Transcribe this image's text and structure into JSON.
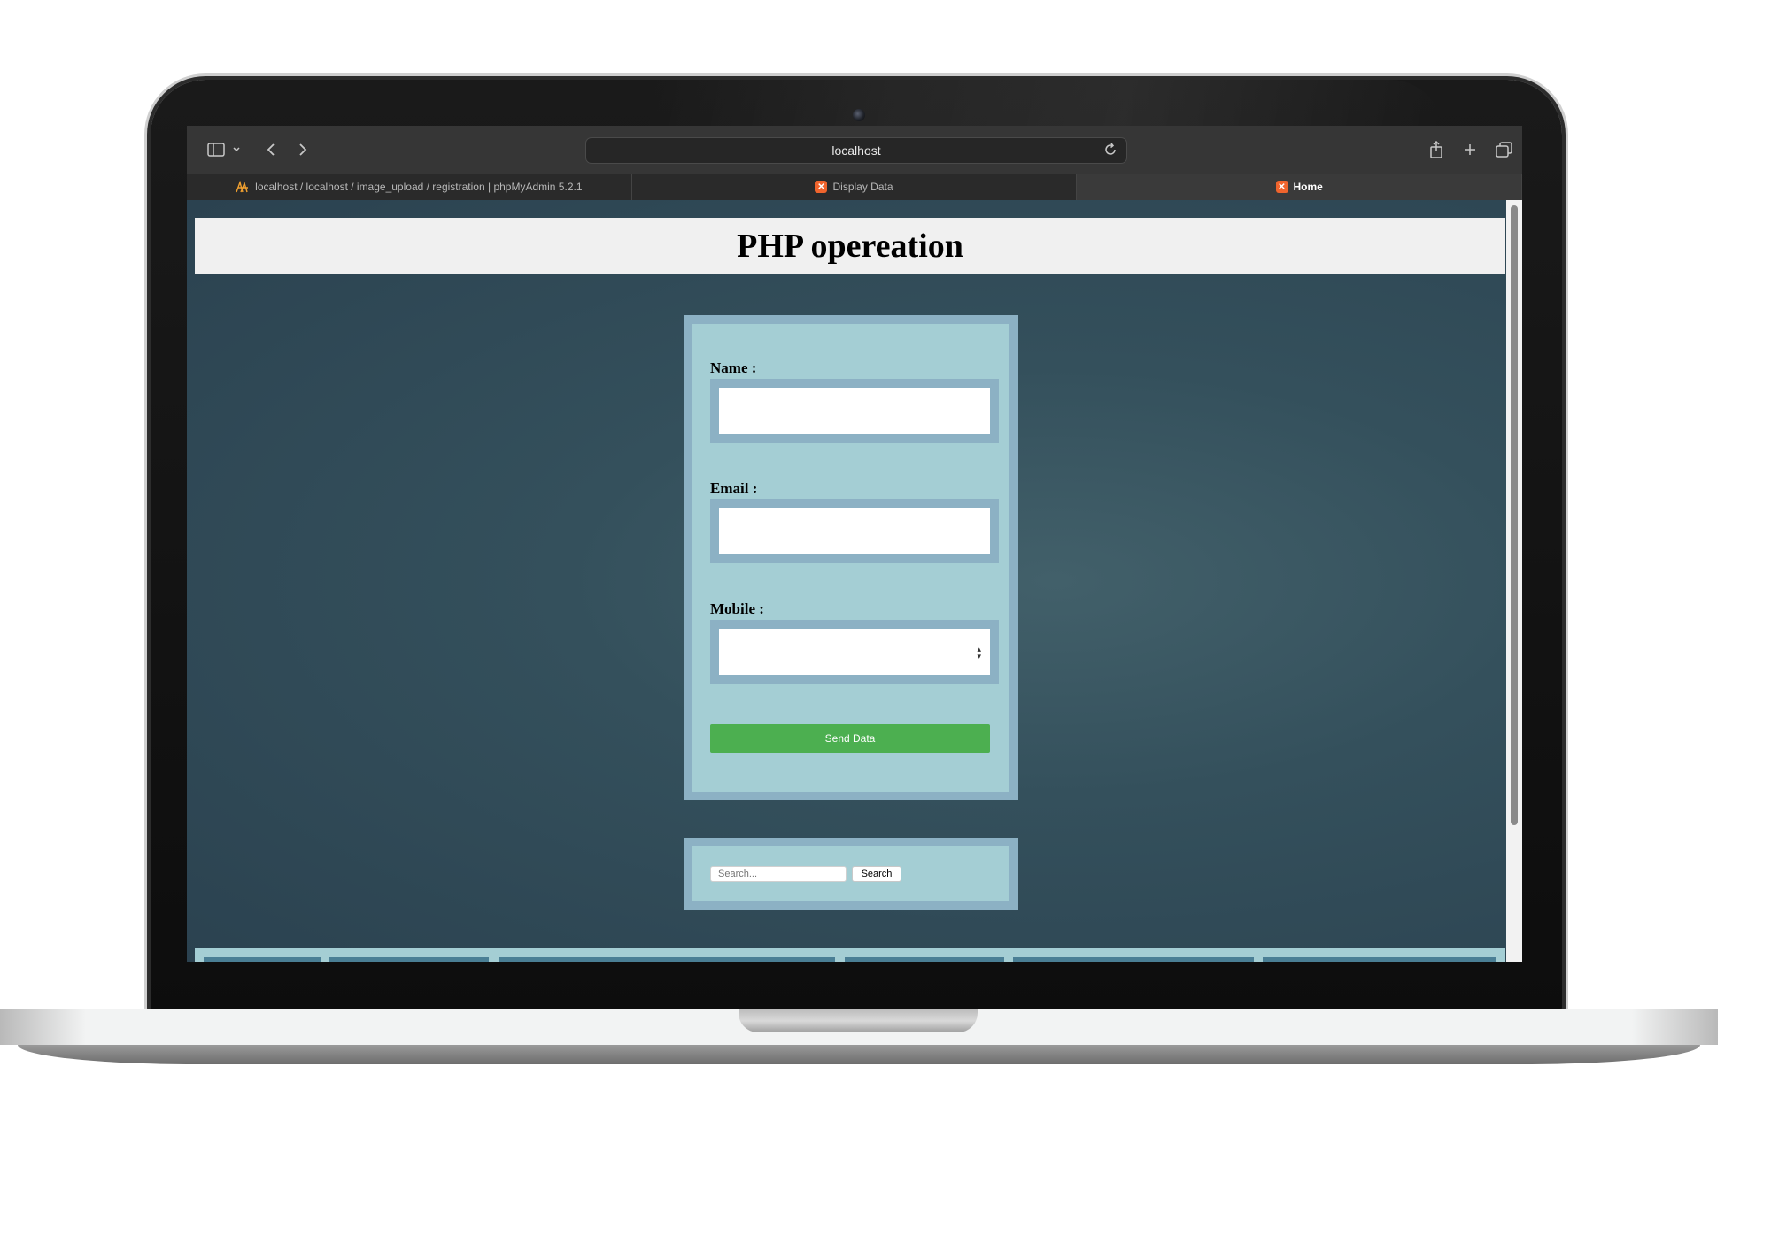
{
  "browser": {
    "url": "localhost",
    "tabs": [
      {
        "label": "localhost / localhost / image_upload / registration | phpMyAdmin 5.2.1",
        "active": false
      },
      {
        "label": "Display Data",
        "active": false
      },
      {
        "label": "Home",
        "active": true
      }
    ]
  },
  "page": {
    "title": "PHP opereation",
    "form": {
      "name_label": "Name :",
      "email_label": "Email :",
      "mobile_label": "Mobile :",
      "submit_label": "Send Data"
    },
    "search": {
      "placeholder": "Search...",
      "button_label": "Search"
    }
  },
  "colors": {
    "page_bg": "#34505c",
    "panel_bg": "#a4ced4",
    "panel_border": "#8cb1c4",
    "submit_green": "#4caf50",
    "header_bg": "#f0f0f0"
  }
}
